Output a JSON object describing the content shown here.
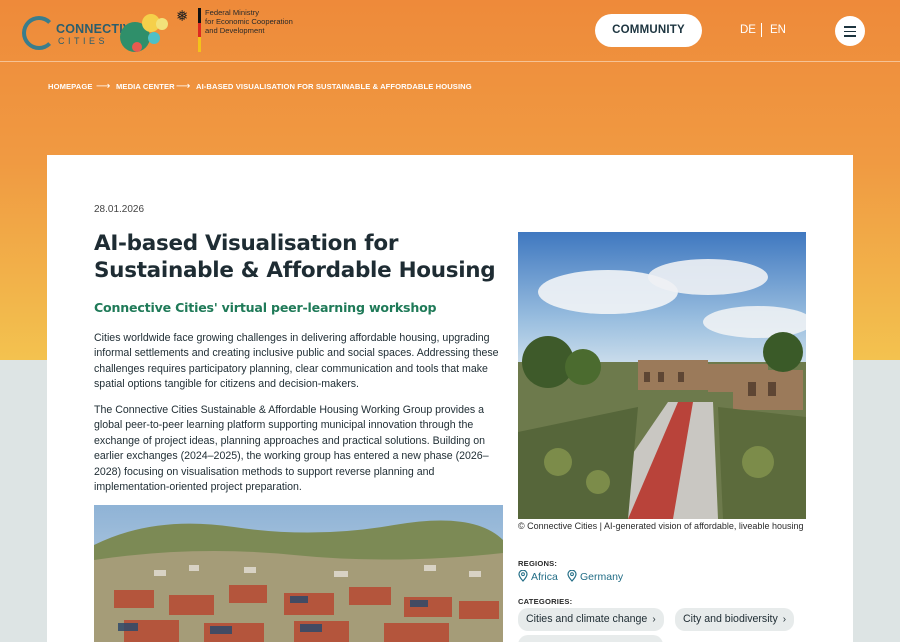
{
  "brand": {
    "logo_line1": "CONNECTIVE",
    "logo_line2": "CITIES",
    "ministry_lines": [
      "Federal Ministry",
      "for Economic Cooperation",
      "and Development"
    ]
  },
  "header": {
    "community_label": "COMMUNITY",
    "lang_de": "DE",
    "lang_en": "EN",
    "menu_icon": "hamburger-menu-icon"
  },
  "breadcrumb": {
    "items": [
      "HOMEPAGE",
      "MEDIA CENTER",
      "AI-BASED VISUALISATION FOR SUSTAINABLE & AFFORDABLE HOUSING"
    ]
  },
  "article": {
    "date": "28.01.2026",
    "title": "AI-based Visualisation for Sustainable & Affordable Housing",
    "subtitle": "Connective Cities' virtual peer-learning workshop",
    "paragraphs": [
      "Cities worldwide face growing challenges in delivering affordable housing, upgrading informal settlements and creating inclusive public and social spaces. Addressing these challenges requires participatory planning, clear communication and tools that make spatial options tangible for citizens and decision-makers.",
      "The Connective Cities Sustainable & Affordable Housing Working Group provides a global peer-to-peer learning platform supporting municipal innovation through the exchange of project ideas, planning approaches and practical solutions. Building on earlier exchanges (2024–2025), the working group has entered a new phase (2026–2028) focusing on visualisation methods to support reverse planning and implementation-oriented project preparation."
    ],
    "image_caption": "© Connective Cities | AI-generated vision of affordable, liveable housing"
  },
  "sidebar": {
    "regions_label": "REGIONS:",
    "regions": [
      "Africa",
      "Germany"
    ],
    "categories_label": "CATEGORIES:",
    "categories": [
      "Cities and climate change",
      "City and biodiversity"
    ]
  },
  "colors": {
    "header_orange": "#ee8a3a",
    "accent_green": "#1f7a58",
    "link_blue": "#226d86"
  }
}
